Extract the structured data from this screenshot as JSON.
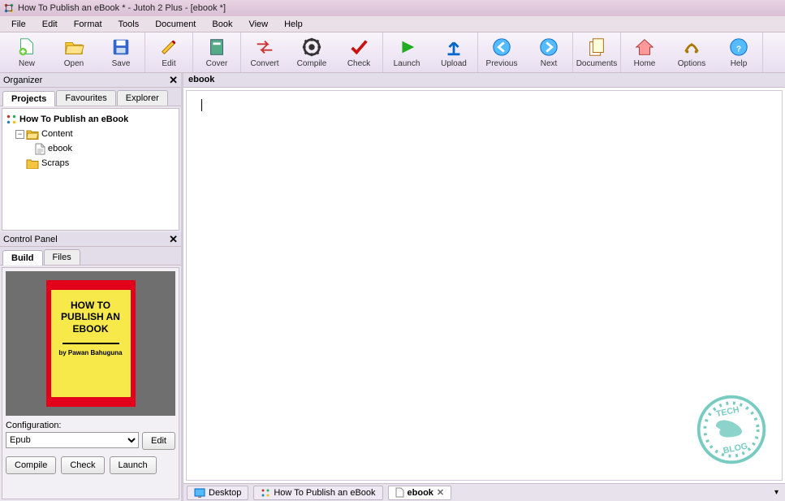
{
  "window": {
    "title": "How To Publish an eBook * - Jutoh 2 Plus - [ebook *]"
  },
  "menu": [
    "File",
    "Edit",
    "Format",
    "Tools",
    "Document",
    "Book",
    "View",
    "Help"
  ],
  "toolbar": {
    "groups": [
      [
        "New",
        "Open",
        "Save"
      ],
      [
        "Edit"
      ],
      [
        "Cover"
      ],
      [
        "Convert",
        "Compile",
        "Check"
      ],
      [
        "Launch",
        "Upload"
      ],
      [
        "Previous",
        "Next"
      ],
      [
        "Documents"
      ],
      [
        "Home",
        "Options",
        "Help"
      ]
    ]
  },
  "organizer": {
    "title": "Organizer",
    "tabs": [
      "Projects",
      "Favourites",
      "Explorer"
    ],
    "active_tab": 0,
    "root": "How To Publish an eBook",
    "nodes": [
      {
        "name": "Content",
        "children": [
          "ebook"
        ]
      },
      {
        "name": "Scraps",
        "children": []
      }
    ]
  },
  "control": {
    "title": "Control Panel",
    "tabs": [
      "Build",
      "Files"
    ],
    "active_tab": 0,
    "cover": {
      "title": "HOW TO PUBLISH AN EBOOK",
      "author": "by Pawan Bahuguna"
    },
    "config_label": "Configuration:",
    "config_value": "Epub",
    "edit_btn": "Edit",
    "compile_btn": "Compile",
    "check_btn": "Check",
    "launch_btn": "Launch"
  },
  "editor": {
    "doc_title": "ebook"
  },
  "bottom_tabs": [
    {
      "label": "Desktop",
      "closable": false
    },
    {
      "label": "How To Publish an eBook",
      "closable": false
    },
    {
      "label": "ebook",
      "closable": true,
      "active": true
    }
  ]
}
